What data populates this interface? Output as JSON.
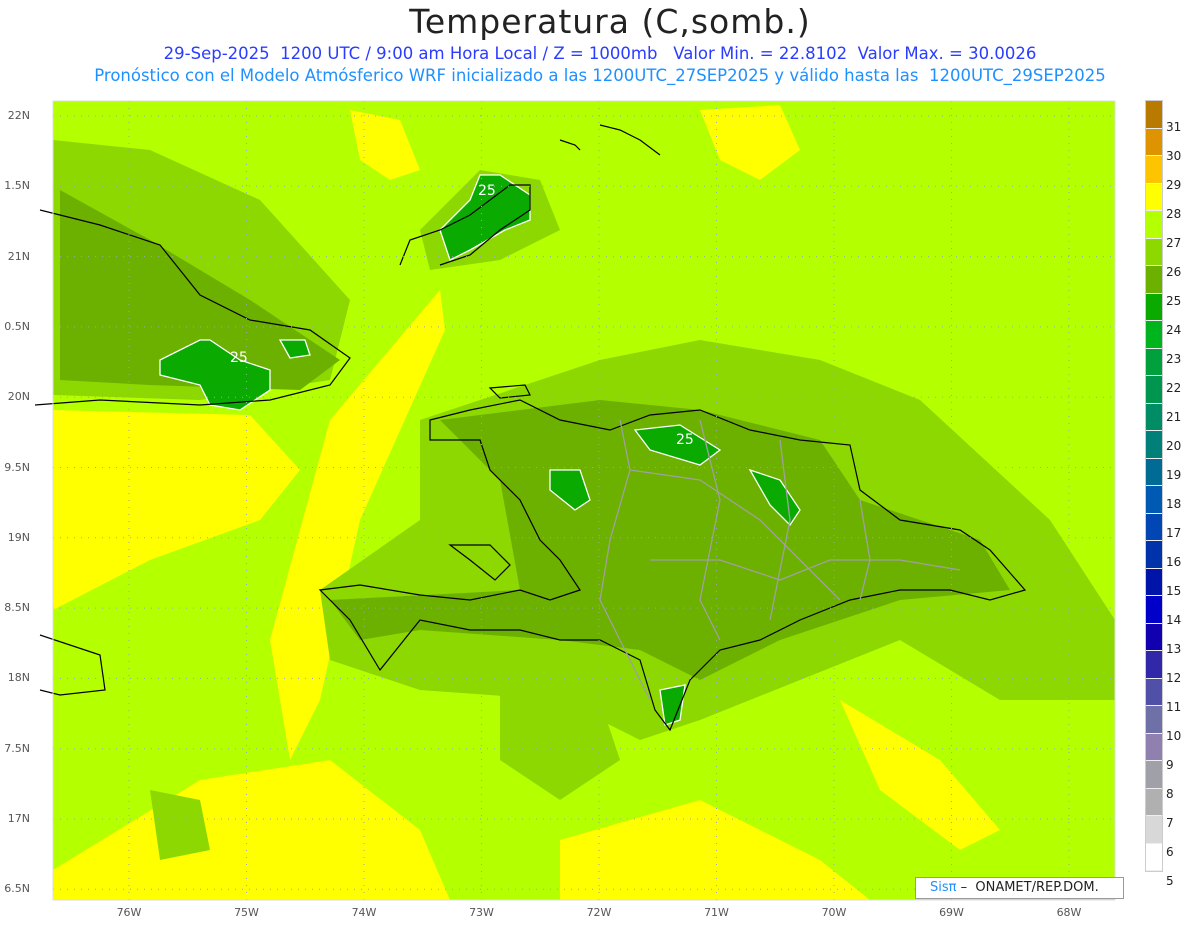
{
  "title": "Temperatura (C,somb.)",
  "subtitle1": "29-Sep-2025  1200 UTC / 9:00 am Hora Local / Z = 1000mb   Valor Min. = 22.8102  Valor Max. = 30.0026",
  "subtitle2": "Pronóstico con el Modelo Atmósferico WRF inicializado a las 1200UTC_27SEP2025 y válido hasta las  1200UTC_29SEP2025",
  "lat_labels": [
    "22N",
    "1.5N",
    "21N",
    "0.5N",
    "20N",
    "9.5N",
    "19N",
    "8.5N",
    "18N",
    "7.5N",
    "17N",
    "6.5N"
  ],
  "lon_labels": [
    "76W",
    "75W",
    "74W",
    "73W",
    "72W",
    "71W",
    "70W",
    "69W",
    "68W"
  ],
  "contour_labels": [
    "25",
    "25",
    "25"
  ],
  "colorbar": {
    "labels": [
      "31",
      "30",
      "29",
      "28",
      "27",
      "26",
      "25",
      "24",
      "23",
      "22",
      "21",
      "20",
      "19",
      "18",
      "17",
      "16",
      "15",
      "14",
      "13",
      "12",
      "11",
      "10",
      "9",
      "8",
      "7",
      "6",
      "5"
    ],
    "colors": [
      "#b87a00",
      "#dd9400",
      "#ffc400",
      "#ffff00",
      "#b4ff00",
      "#8cd800",
      "#6cb000",
      "#0aaa00",
      "#00b41e",
      "#00a03c",
      "#009650",
      "#008c64",
      "#008078",
      "#006c96",
      "#005ab4",
      "#0046b4",
      "#0032aa",
      "#0014aa",
      "#0000c8",
      "#1000b0",
      "#3028a8",
      "#5050a8",
      "#7070a8",
      "#9080b0",
      "#a0a0a8",
      "#b0b0b0",
      "#d8d8d8",
      "#ffffff"
    ]
  },
  "credit": {
    "brand": "Sisπ",
    "text": " –  ONAMET/REP.DOM."
  }
}
